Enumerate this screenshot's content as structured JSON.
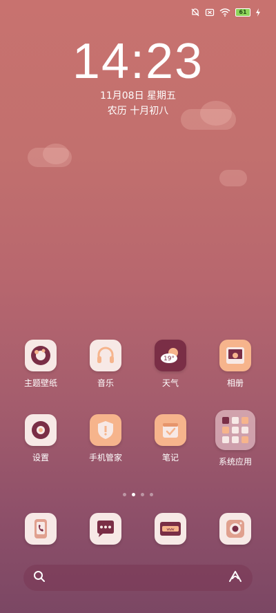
{
  "status_bar": {
    "icons": [
      "mute-bell-icon",
      "no-sim-icon",
      "wifi-icon",
      "battery-icon",
      "charging-icon"
    ],
    "battery_level": "61"
  },
  "lockscreen": {
    "time": "14:23",
    "date": "11月08日 星期五",
    "lunar": "农历 十月初八"
  },
  "apps_row1": [
    {
      "label": "主题壁纸",
      "icon": "theme-wallpaper-icon"
    },
    {
      "label": "音乐",
      "icon": "music-headphones-icon"
    },
    {
      "label": "天气",
      "icon": "weather-icon",
      "temp": "19°"
    },
    {
      "label": "相册",
      "icon": "gallery-icon"
    }
  ],
  "apps_row2": [
    {
      "label": "设置",
      "icon": "settings-icon"
    },
    {
      "label": "手机管家",
      "icon": "phone-manager-icon"
    },
    {
      "label": "笔记",
      "icon": "notes-icon"
    },
    {
      "label": "系统应用",
      "icon": "system-apps-folder-icon"
    }
  ],
  "dock": [
    {
      "icon": "phone-icon"
    },
    {
      "icon": "messages-icon"
    },
    {
      "icon": "browser-icon"
    },
    {
      "icon": "camera-icon"
    }
  ],
  "page_indicator": {
    "count": 4,
    "active": 1
  },
  "colors": {
    "accent_peach": "#f6b48c",
    "dark_plum": "#7a2e46",
    "icon_bg_light": "#f7e9e6"
  }
}
